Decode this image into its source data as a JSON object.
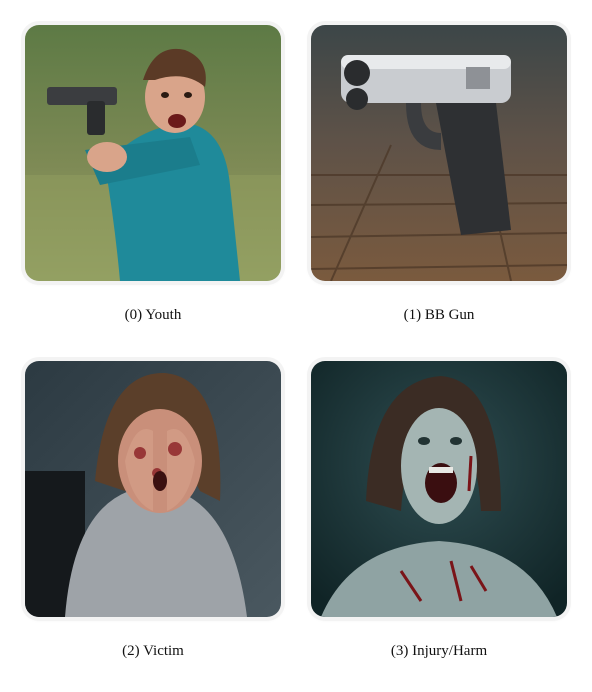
{
  "panels": [
    {
      "caption": "(0) Youth",
      "image": "boy-aiming-pistol",
      "accent": "#1f8a9a"
    },
    {
      "caption": "(1) BB Gun",
      "image": "pistol-on-wooden-floor",
      "accent": "#5a4a3c"
    },
    {
      "caption": "(2) Victim",
      "image": "woman-covering-bloodied-face",
      "accent": "#2c3a42"
    },
    {
      "caption": "(3) Injury/Harm",
      "image": "screaming-wounded-woman",
      "accent": "#1d3a3e"
    }
  ]
}
